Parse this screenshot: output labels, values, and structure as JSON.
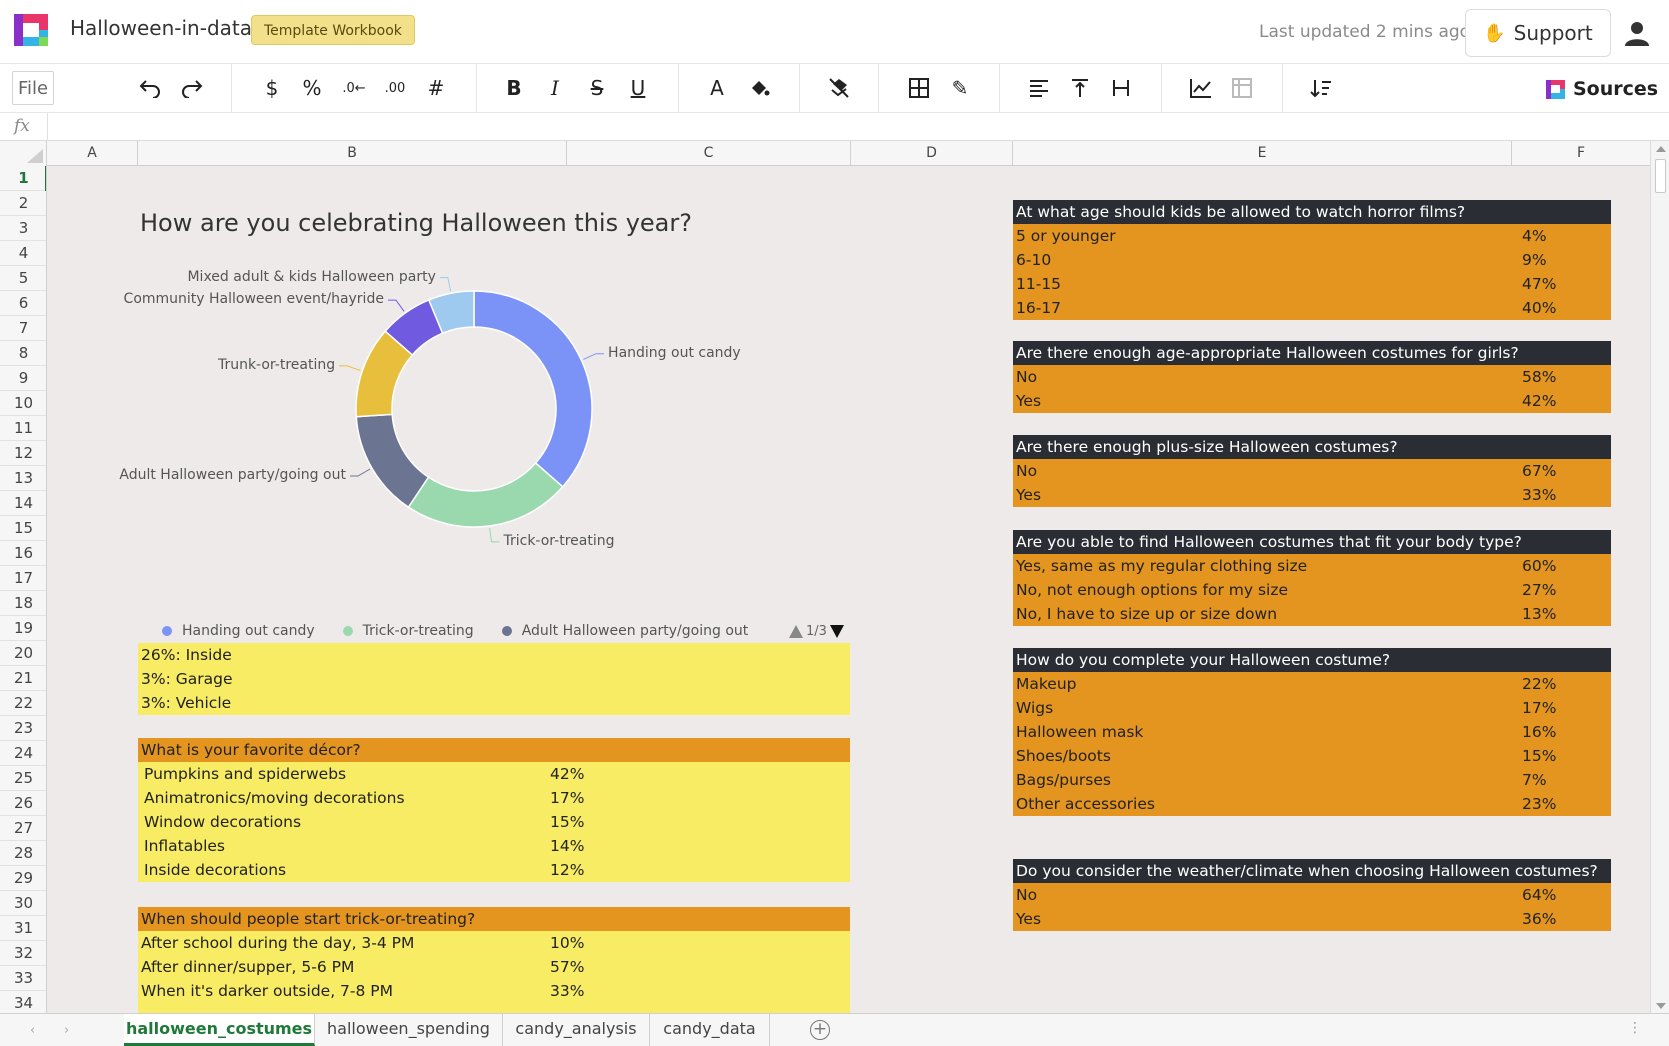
{
  "header": {
    "title": "Halloween-in-data",
    "badge": "Template Workbook",
    "last_updated": "Last updated 2 mins ago",
    "support_label": "Support",
    "brand_colors": [
      "#8b2fc9",
      "#e8356a",
      "#34b4e4",
      "#7ed957"
    ]
  },
  "toolbar": {
    "file_label": "File",
    "sources_label": "Sources",
    "icons": [
      "undo-icon",
      "redo-icon",
      "currency-icon",
      "percent-icon",
      "decrease-decimal-icon",
      "increase-decimal-icon",
      "number-format-icon",
      "bold-icon",
      "italic-icon",
      "strikethrough-icon",
      "underline-icon",
      "text-color-icon",
      "fill-color-icon",
      "clear-format-icon",
      "borders-icon",
      "edit-icon",
      "align-left-icon",
      "align-top-icon",
      "text-wrap-icon",
      "chart-icon",
      "pivot-icon",
      "sort-icon"
    ]
  },
  "formula_bar": {
    "fx_label": "fx",
    "value": ""
  },
  "columns": [
    "A",
    "B",
    "C",
    "D",
    "E",
    "F"
  ],
  "rows": [
    "1",
    "2",
    "3",
    "4",
    "5",
    "6",
    "7",
    "8",
    "9",
    "10",
    "11",
    "12",
    "13",
    "14",
    "15",
    "16",
    "17",
    "18",
    "19",
    "20",
    "21",
    "22",
    "23",
    "24",
    "25",
    "26",
    "27",
    "28",
    "29",
    "30",
    "31",
    "32",
    "33",
    "34"
  ],
  "active_row": "1",
  "chart": {
    "title": "How are you celebrating Halloween this year?",
    "legend_page": "1/3"
  },
  "chart_data": {
    "type": "pie",
    "donut": true,
    "title": "How are you celebrating Halloween this year?",
    "categories": [
      "Handing out candy",
      "Trick-or-treating",
      "Adult Halloween party/going out",
      "Trunk-or-treating",
      "Community Halloween event/hayride",
      "Mixed adult & kids Halloween party"
    ],
    "values": [
      35,
      22,
      14,
      12,
      7,
      6
    ],
    "colors": [
      "#7b93f6",
      "#9ad8ad",
      "#6b7592",
      "#e8bf3c",
      "#6f5ae0",
      "#9dcaee"
    ],
    "legend": {
      "placement": "bottom",
      "visible_entries": [
        "Handing out candy",
        "Trick-or-treating",
        "Adult Halloween party/going out"
      ]
    }
  },
  "yellow_notes": [
    "26%: Inside",
    "3%: Garage",
    "3%: Vehicle"
  ],
  "decor": {
    "title": "What is your favorite décor?",
    "rows": [
      {
        "label": "Pumpkins and spiderwebs",
        "value": "42%"
      },
      {
        "label": "Animatronics/moving decorations",
        "value": "17%"
      },
      {
        "label": "Window decorations",
        "value": "15%"
      },
      {
        "label": "Inflatables",
        "value": "14%"
      },
      {
        "label": "Inside decorations",
        "value": "12%"
      }
    ]
  },
  "trick": {
    "title": "When should people start trick-or-treating?",
    "rows": [
      {
        "label": "After school during the day, 3-4 PM",
        "value": "10%"
      },
      {
        "label": "After dinner/supper, 5-6 PM",
        "value": "57%"
      },
      {
        "label": "When it's darker outside, 7-8 PM",
        "value": "33%"
      }
    ]
  },
  "survey": [
    {
      "title": "At what age should kids be allowed to watch horror films?",
      "rows": [
        {
          "label": "5 or younger",
          "value": "4%"
        },
        {
          "label": "6-10",
          "value": "9%"
        },
        {
          "label": "11-15",
          "value": "47%"
        },
        {
          "label": "16-17",
          "value": "40%"
        }
      ]
    },
    {
      "title": "Are there enough age-appropriate Halloween costumes for girls?",
      "rows": [
        {
          "label": "No",
          "value": "58%"
        },
        {
          "label": "Yes",
          "value": "42%"
        }
      ]
    },
    {
      "title": "Are there enough plus-size Halloween costumes?",
      "rows": [
        {
          "label": "No",
          "value": "67%"
        },
        {
          "label": "Yes",
          "value": "33%"
        }
      ]
    },
    {
      "title": "Are you able to find Halloween costumes that fit your body type?",
      "rows": [
        {
          "label": "Yes, same as my regular clothing size",
          "value": "60%"
        },
        {
          "label": "No, not enough options for my size",
          "value": "27%"
        },
        {
          "label": "No, I have to size up or size down",
          "value": "13%"
        }
      ]
    },
    {
      "title": "How do you complete your Halloween costume?",
      "rows": [
        {
          "label": "Makeup",
          "value": "22%"
        },
        {
          "label": "Wigs",
          "value": "17%"
        },
        {
          "label": "Halloween mask",
          "value": "16%"
        },
        {
          "label": "Shoes/boots",
          "value": "15%"
        },
        {
          "label": "Bags/purses",
          "value": "7%"
        },
        {
          "label": "Other accessories",
          "value": "23%"
        }
      ]
    },
    {
      "title": "Do you consider the weather/climate when choosing Halloween costumes?",
      "rows": [
        {
          "label": "No",
          "value": "64%"
        },
        {
          "label": "Yes",
          "value": "36%"
        }
      ]
    }
  ],
  "sheet_tabs": [
    "halloween_costumes",
    "halloween_spending",
    "candy_analysis",
    "candy_data"
  ],
  "active_tab": "halloween_costumes"
}
